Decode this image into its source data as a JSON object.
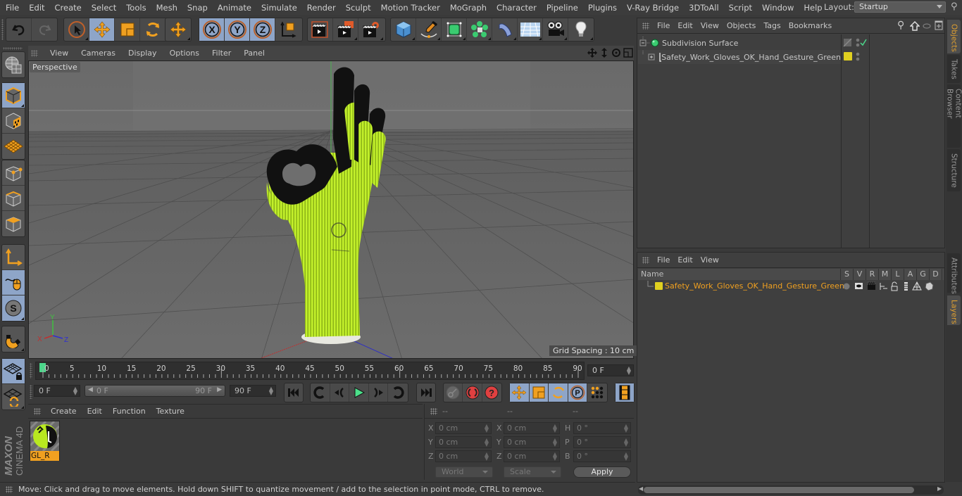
{
  "menubar": {
    "items": [
      "File",
      "Edit",
      "Create",
      "Select",
      "Tools",
      "Mesh",
      "Snap",
      "Animate",
      "Simulate",
      "Render",
      "Sculpt",
      "Motion Tracker",
      "MoGraph",
      "Character",
      "Pipeline",
      "Plugins",
      "V-Ray Bridge",
      "3DToAll",
      "Script",
      "Window",
      "Help"
    ],
    "layout_label": "Layout:",
    "layout_value": "Startup"
  },
  "toolbar": {
    "groups": [
      [
        "undo-icon",
        "redo-icon"
      ],
      [
        "live-selection-icon",
        "move-icon",
        "scale-icon",
        "rotate-icon"
      ],
      [
        "recent-tool-icon"
      ],
      [
        "x-axis-lock-icon",
        "y-axis-lock-icon",
        "z-axis-lock-icon",
        "coordinate-system-icon"
      ],
      [
        "render-view-icon",
        "render-to-picture-viewer-icon",
        "render-settings-icon"
      ],
      [
        "cube-primitive-icon",
        "pen-spline-icon",
        "subdivision-surface-icon",
        "cloner-icon",
        "deformer-icon",
        "floor-icon",
        "camera-icon",
        "light-icon"
      ]
    ]
  },
  "left_tools": [
    "make-editable-icon",
    "model-mode-icon",
    "texture-mode-icon",
    "workplane-mode-icon",
    "points-mode-icon",
    "edges-mode-icon",
    "polygons-mode-icon",
    "axis-mode-icon",
    "tweak-mode-icon",
    "solo-mode-icon",
    "snap-icon",
    "workplane-lock-icon",
    "workplane-align-icon"
  ],
  "viewport": {
    "menu": [
      "View",
      "Cameras",
      "Display",
      "Options",
      "Filter",
      "Panel"
    ],
    "camera_label": "Perspective",
    "grid_spacing": "Grid Spacing : 10 cm",
    "axis": {
      "x": "X",
      "y": "Y",
      "z": "Z"
    },
    "object_name": "Safety_Work_Gloves_OK_Hand_Gesture_Green"
  },
  "timeline": {
    "ticks": [
      "0",
      "5",
      "10",
      "15",
      "20",
      "25",
      "30",
      "35",
      "40",
      "45",
      "50",
      "55",
      "60",
      "65",
      "70",
      "75",
      "80",
      "85",
      "90"
    ],
    "current_frame": "0 F",
    "min_frame_field": "0 F",
    "range_start": "0 F",
    "range_end": "90 F",
    "max_frame_field": "90 F",
    "playhead_color": "#4cd68a"
  },
  "materials": {
    "menu": [
      "Create",
      "Edit",
      "Function",
      "Texture"
    ],
    "items": [
      {
        "name": "GL_R",
        "selected": true
      }
    ]
  },
  "coordinates": {
    "headers": [
      "--",
      "--",
      "--"
    ],
    "position": [
      {
        "axis": "X",
        "value": "0 cm"
      },
      {
        "axis": "Y",
        "value": "0 cm"
      },
      {
        "axis": "Z",
        "value": "0 cm"
      }
    ],
    "size": [
      {
        "axis": "X",
        "value": "0 cm"
      },
      {
        "axis": "Y",
        "value": "0 cm"
      },
      {
        "axis": "Z",
        "value": "0 cm"
      }
    ],
    "rotation": [
      {
        "axis": "H",
        "value": "0 °"
      },
      {
        "axis": "P",
        "value": "0 °"
      },
      {
        "axis": "B",
        "value": "0 °"
      }
    ],
    "mode_select": "World",
    "size_select": "Scale",
    "apply_label": "Apply"
  },
  "status": {
    "text": "Move: Click and drag to move elements. Hold down SHIFT to quantize movement / add to the selection in point mode, CTRL to remove."
  },
  "objects_panel": {
    "menu": [
      "File",
      "Edit",
      "View",
      "Objects",
      "Tags",
      "Bookmarks"
    ],
    "items": [
      {
        "name": "Subdivision Surface",
        "type": "subdivision-surface",
        "expanded": true,
        "enabled": true
      },
      {
        "name": "Safety_Work_Gloves_OK_Hand_Gesture_Green",
        "type": "null",
        "expanded": false,
        "layer_color": "#e0d020"
      }
    ]
  },
  "side_tabs": {
    "top": [
      {
        "label": "Objects",
        "active": true
      },
      {
        "label": "Takes",
        "active": false
      },
      {
        "label": "Content Browser",
        "active": false
      },
      {
        "label": "Structure",
        "active": false
      }
    ],
    "bottom": [
      {
        "label": "Attributes",
        "active": false
      },
      {
        "label": "Layers",
        "active": true
      }
    ]
  },
  "layers_panel": {
    "menu": [
      "File",
      "Edit",
      "View"
    ],
    "columns": [
      "Name",
      "S",
      "V",
      "R",
      "M",
      "L",
      "A",
      "G",
      "D"
    ],
    "rows": [
      {
        "name": "Safety_Work_Gloves_OK_Hand_Gesture_Green",
        "color": "#e0d020"
      }
    ]
  },
  "colors": {
    "accent_orange": "#f0a020",
    "active_blue": "#8ea5c8",
    "layer_yellow": "#e0d020",
    "glove_green": "#b8ee20"
  }
}
